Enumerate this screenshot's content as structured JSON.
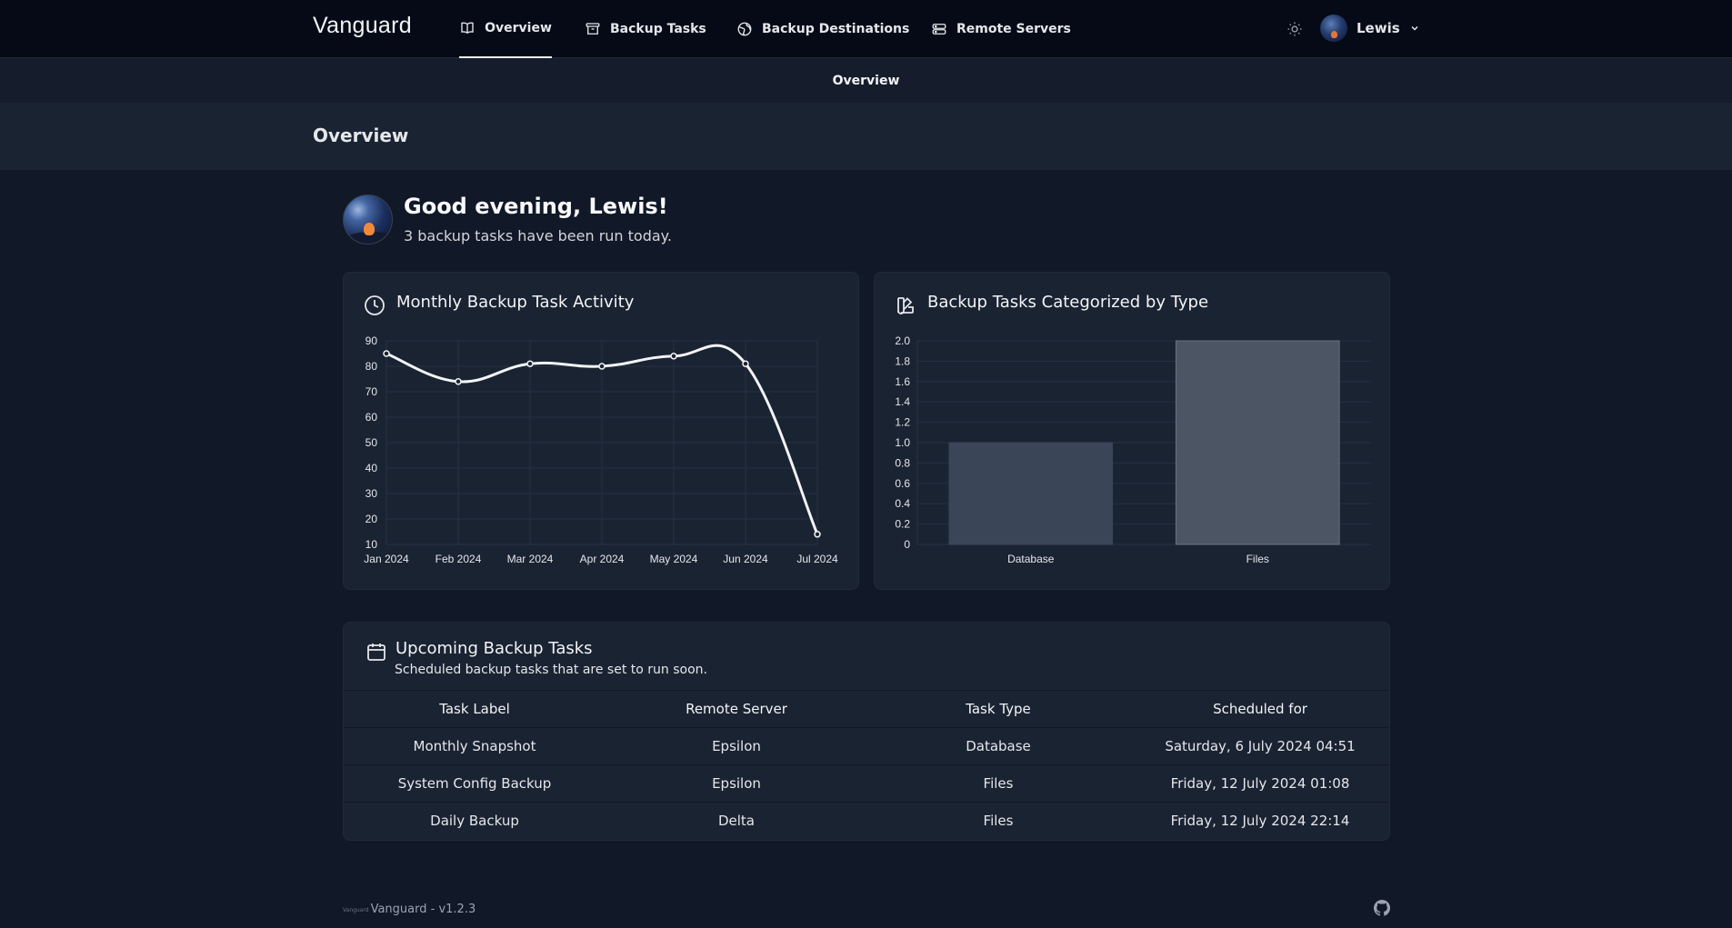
{
  "brand": {
    "name": "Vanguard"
  },
  "nav": {
    "items": [
      {
        "label": "Overview",
        "icon": "book-open-icon",
        "active": true
      },
      {
        "label": "Backup Tasks",
        "icon": "archive-icon",
        "active": false
      },
      {
        "label": "Backup Destinations",
        "icon": "globe-icon",
        "active": false
      },
      {
        "label": "Remote Servers",
        "icon": "server-icon",
        "active": false
      }
    ],
    "theme_icon": "sun-icon",
    "user": {
      "name": "Lewis",
      "icon": "chevron-down-icon"
    }
  },
  "subnav": {
    "label": "Overview"
  },
  "page": {
    "title": "Overview"
  },
  "greeting": {
    "title": "Good evening, Lewis!",
    "subtitle": "3 backup tasks have been run today."
  },
  "activity_card": {
    "title": "Monthly Backup Task Activity",
    "icon": "clock-icon"
  },
  "type_card": {
    "title": "Backup Tasks Categorized by Type",
    "icon": "swatch-icon"
  },
  "chart_data": [
    {
      "type": "line",
      "title": "Monthly Backup Task Activity",
      "categories": [
        "Jan 2024",
        "Feb 2024",
        "Mar 2024",
        "Apr 2024",
        "May 2024",
        "Jun 2024",
        "Jul 2024"
      ],
      "series": [
        {
          "values": [
            85,
            74,
            81,
            80,
            84,
            81,
            14
          ]
        }
      ],
      "ylim": [
        10,
        90
      ],
      "yticks": [
        90,
        80,
        70,
        60,
        50,
        40,
        30,
        20,
        10
      ],
      "grid": true,
      "colors": {
        "line": "#f3f4f6",
        "grid": "#253043",
        "tick": "#e5e7eb"
      }
    },
    {
      "type": "bar",
      "title": "Backup Tasks Categorized by Type",
      "categories": [
        "Database",
        "Files"
      ],
      "values": [
        1,
        2
      ],
      "ylim": [
        0,
        2
      ],
      "yticks": [
        "2.0",
        "1.8",
        "1.6",
        "1.4",
        "1.2",
        "1.0",
        "0.8",
        "0.6",
        "0.4",
        "0.2",
        "0"
      ],
      "grid": true,
      "colors": {
        "bars": [
          "#3b4558",
          "#4b5563"
        ],
        "bar_border": [
          "#3b4558",
          "#6b7280"
        ],
        "grid": "#253043",
        "tick": "#e5e7eb"
      }
    }
  ],
  "upcoming": {
    "title": "Upcoming Backup Tasks",
    "subtitle": "Scheduled backup tasks that are set to run soon.",
    "icon": "calendar-icon",
    "columns": [
      "Task Label",
      "Remote Server",
      "Task Type",
      "Scheduled for"
    ],
    "rows": [
      [
        "Monthly Snapshot",
        "Epsilon",
        "Database",
        "Saturday, 6 July 2024 04:51"
      ],
      [
        "System Config Backup",
        "Epsilon",
        "Files",
        "Friday, 12 July 2024 01:08"
      ],
      [
        "Daily Backup",
        "Delta",
        "Files",
        "Friday, 12 July 2024 22:14"
      ]
    ]
  },
  "footer": {
    "mini_logo": "Vanguard",
    "version": "Vanguard - v1.2.3",
    "icon": "github-icon"
  }
}
